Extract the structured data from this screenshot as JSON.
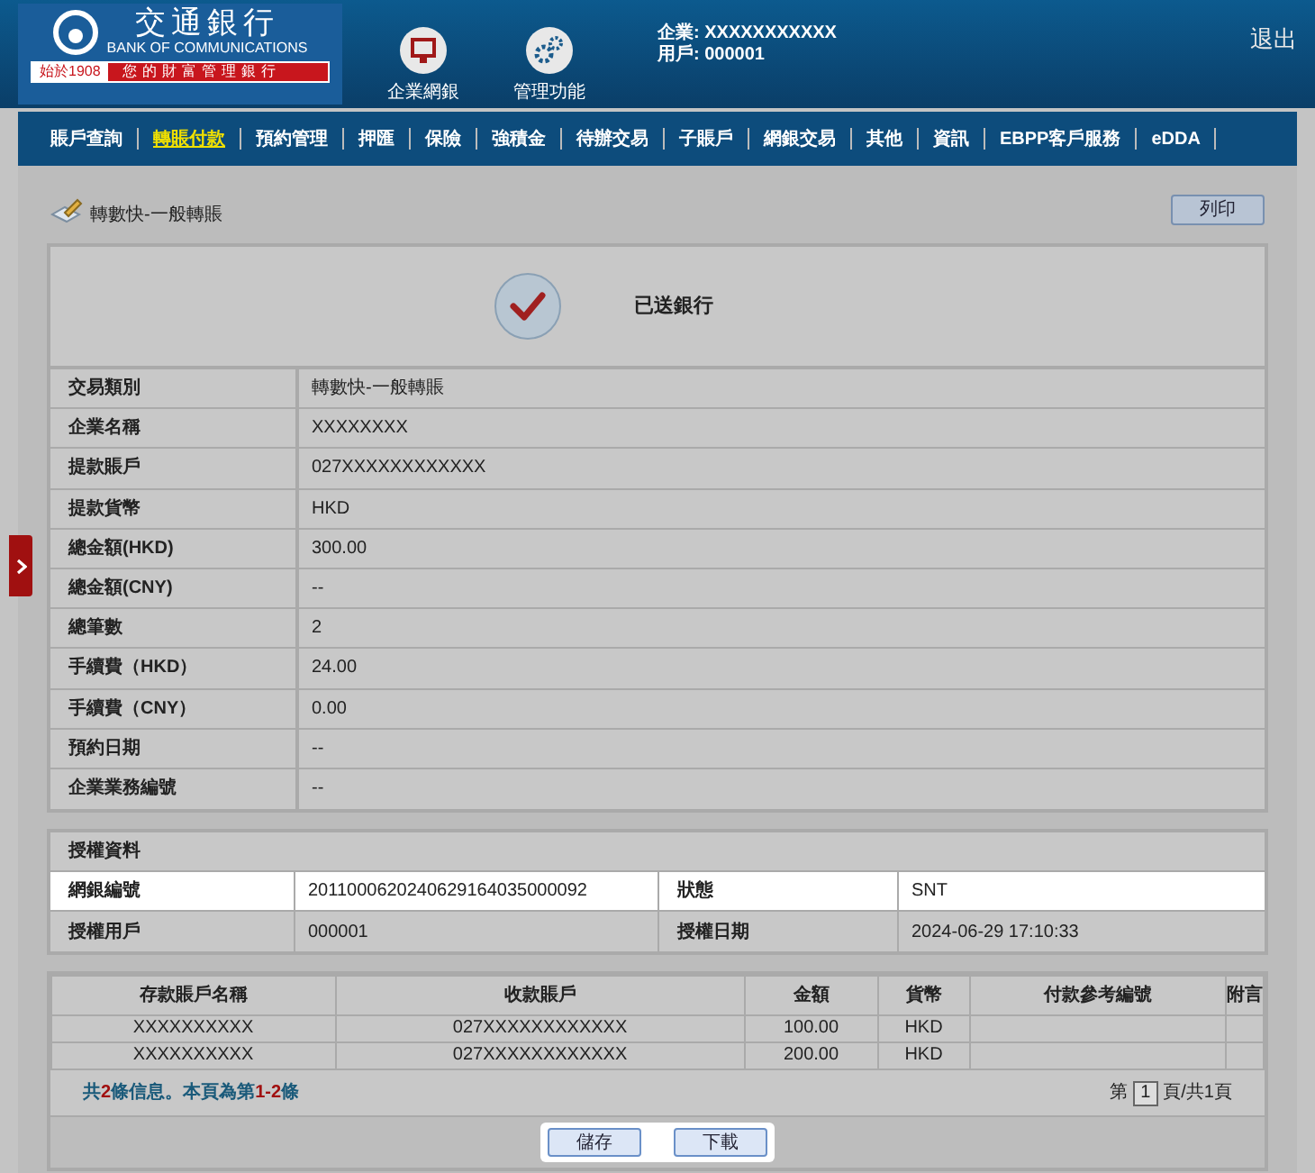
{
  "header": {
    "logo": {
      "name_zh": "交通銀行",
      "name_en": "BANK OF COMMUNICATIONS",
      "since": "始於1908",
      "slogan": "您的財富管理銀行"
    },
    "nav_icons": [
      {
        "kind": "monitor",
        "label": "企業網銀"
      },
      {
        "kind": "gears",
        "label": "管理功能"
      }
    ],
    "user_lines": [
      "企業: XXXXXXXXXXX",
      "用戶: 000001"
    ],
    "logout": "退出"
  },
  "menu": [
    {
      "label": "賬戶查詢",
      "selected": false
    },
    {
      "label": "轉賬付款",
      "selected": true
    },
    {
      "label": "預約管理",
      "selected": false
    },
    {
      "label": "押匯",
      "selected": false
    },
    {
      "label": "保險",
      "selected": false
    },
    {
      "label": "強積金",
      "selected": false
    },
    {
      "label": "待辦交易",
      "selected": false
    },
    {
      "label": "子賬戶",
      "selected": false
    },
    {
      "label": "網銀交易",
      "selected": false
    },
    {
      "label": "其他",
      "selected": false
    },
    {
      "label": "資訊",
      "selected": false
    },
    {
      "label": "EBPP客戶服務",
      "selected": false
    },
    {
      "label": "eDDA",
      "selected": false
    }
  ],
  "page_title": "轉數快-一般轉賬",
  "print_button": "列印",
  "status": "已送銀行",
  "details": [
    {
      "label": "交易類別",
      "value": "轉數快-一般轉賬"
    },
    {
      "label": "企業名稱",
      "value": "XXXXXXXX"
    },
    {
      "label": "提款賬戶",
      "value": "027XXXXXXXXXXXX"
    },
    {
      "label": "提款貨幣",
      "value": "HKD"
    },
    {
      "label": "總金額(HKD)",
      "value": "300.00"
    },
    {
      "label": "總金額(CNY)",
      "value": "--"
    },
    {
      "label": "總筆數",
      "value": "2"
    },
    {
      "label": "手續費（HKD）",
      "value": "24.00"
    },
    {
      "label": "手續費（CNY）",
      "value": "0.00"
    },
    {
      "label": "預約日期",
      "value": "--"
    },
    {
      "label": "企業業務編號",
      "value": "--"
    }
  ],
  "auth": {
    "title": "授權資料",
    "rows": [
      {
        "highlighted": true,
        "cells": [
          {
            "label": "網銀編號",
            "value": "2011000620240629164035000092"
          },
          {
            "label": "狀態",
            "value": "SNT"
          }
        ]
      },
      {
        "highlighted": false,
        "cells": [
          {
            "label": "授權用戶",
            "value": "000001"
          },
          {
            "label": "授權日期",
            "value": "2024-06-29 17:10:33"
          }
        ]
      }
    ]
  },
  "table": {
    "columns": [
      "存款賬戶名稱",
      "收款賬戶",
      "金額",
      "貨幣",
      "付款參考編號",
      "附言"
    ],
    "rows": [
      [
        "XXXXXXXXXX",
        "027XXXXXXXXXXXX",
        "100.00",
        "HKD",
        "",
        ""
      ],
      [
        "XXXXXXXXXX",
        "027XXXXXXXXXXXX",
        "200.00",
        "HKD",
        "",
        ""
      ]
    ],
    "summary": [
      {
        "text": "共",
        "emphasis": false
      },
      {
        "text": "2",
        "emphasis": true
      },
      {
        "text": "條信息。本頁為第",
        "emphasis": false
      },
      {
        "text": "1-2",
        "emphasis": true
      },
      {
        "text": "條",
        "emphasis": false
      }
    ],
    "pager": {
      "prefix": "第",
      "page": "1",
      "suffix": "頁/共1頁"
    }
  },
  "buttons": [
    "儲存",
    "下載"
  ]
}
